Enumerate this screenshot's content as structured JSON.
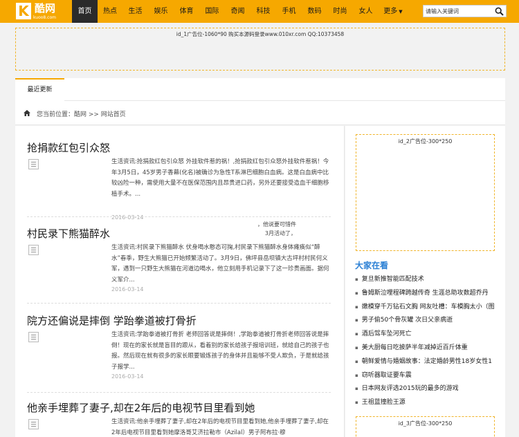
{
  "brand": {
    "mark": "K",
    "name": "酷网",
    "domain": "kuoo8.com",
    "accent": "#f6a800"
  },
  "nav": {
    "items": [
      "首页",
      "热点",
      "生活",
      "娱乐",
      "体育",
      "国际",
      "奇闻",
      "科技",
      "手机",
      "数码",
      "时尚",
      "女人",
      "更多"
    ],
    "active": "首页"
  },
  "search": {
    "placeholder": "请输入关键词"
  },
  "ad1": {
    "text": "id_1广告位-1060*90 购买本源码登录www.010xr.com QQ:10373458"
  },
  "tabs": {
    "active_label": "最近更新"
  },
  "breadcrumb": {
    "text": "您当前位置：酷网 >> 网站首页"
  },
  "articles": [
    {
      "title": "抢捐款红包引众怒",
      "body": "生活资讯:抢捐款红包引众怒 外挂软件惹的祸！,抢捐款红包引众怒外挂软件惹祸！今年3月5日，45岁男子香幕(化名)被确诊为急性T系淋巴细胞白血病。这是白血病中比较凶险一种，需使用大量不在医保范围内且昂贵进口药，另外还要接受造血干细胞移植手术。...",
      "date": "2016-03-14"
    },
    {
      "title": "村民录下熊猫醉水",
      "body": "生活资讯:村民录下熊猫醉水 伏身喝水憨态可掬,村民录下熊猫醉水身体瘫痪似“醉水”春季，野生大熊猫已开始频繁活动了。3月9日，佛坪县岳坝镇大古坪村村民何义军，遇到一只野生大熊猫在河道边喝水，他立刻用手机记录下了这一珍贵画面。据何义军介...",
      "date": "2016-03-14"
    },
    {
      "title": "院方还偏说是摔倒 学跆拳道被打骨折",
      "body": "生活资讯:学跆拳道被打骨折 老师回答说是摔倒！,学跆拳道被打骨折老师回答说是摔倒！现在的家长就是盲目的跟从，看着别的家长给孩子报培训班，就给自己的孩子也报。然后现在就有很多的家长眼要锻炼孩子的身体并且能够不受人欺负，于是就给孩子报学...",
      "date": "2016-03-14"
    },
    {
      "title": "他亲手埋葬了妻子,却在2年后的电视节目里看到她",
      "body": "生活资讯:他亲手埋葬了妻子,却在2年后的电视节目里看到她,他亲手埋葬了妻子,却在2年后电视节目里看到她摩洛哥艾济拉勒市（Azilal）男子阿布拉·穆",
      "date": ""
    }
  ],
  "float_note": {
    "line1": "，他说要可惜件",
    "line2": "3月活动了，"
  },
  "sidebar": {
    "ad2": "id_2广告位-300*250",
    "hot_title": "大家在看",
    "hot_items": [
      "复旦新推智能匹配技术",
      "鲁姆斯泣哩程碑跨越传奇 生涯总助攻数超乔丹",
      "嫩模穿千万钻石文胸 网友吐槽：车模胸太小（图",
      "男子偷50个骨灰罐 次日父亲病逝",
      "酒后驾车坠河死亡",
      "美大厨每日吃披萨半年减掉近百斤体重",
      "朝鲜爱情与婚姻故事：法定婚龄男性18岁女性1",
      "窃听器取证要车震",
      "日本网友评选2015玩的最多的游戏",
      "王祖蓝撞脸王源"
    ],
    "ad3": "id_3广告位-300*250"
  }
}
